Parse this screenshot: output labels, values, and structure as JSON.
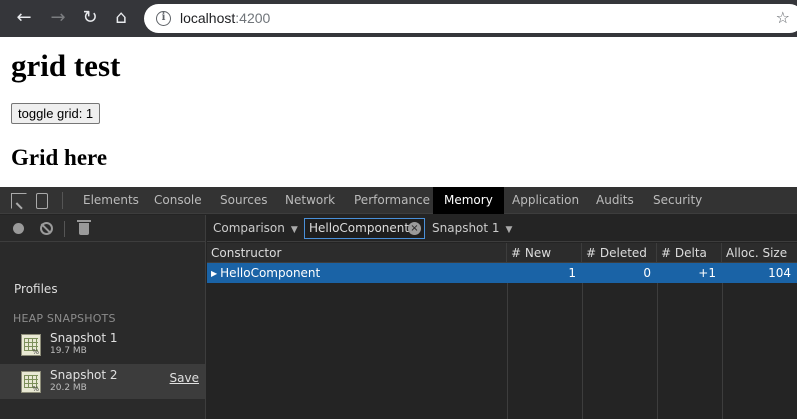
{
  "browser": {
    "url_host": "localhost",
    "url_port": ":4200"
  },
  "page": {
    "title": "grid test",
    "toggle_button": "toggle grid: 1",
    "subtitle": "Grid here"
  },
  "devtools": {
    "tabs": [
      "Elements",
      "Console",
      "Sources",
      "Network",
      "Performance",
      "Memory",
      "Application",
      "Audits",
      "Security"
    ],
    "active_tab": "Memory",
    "sidebar": {
      "profiles_label": "Profiles",
      "heap_header": "HEAP SNAPSHOTS",
      "snapshots": [
        {
          "name": "Snapshot 1",
          "size": "19.7 MB"
        },
        {
          "name": "Snapshot 2",
          "size": "20.2 MB",
          "action": "Save"
        }
      ]
    },
    "toolbar": {
      "view": "Comparison",
      "filter_value": "HelloComponent",
      "base_snapshot": "Snapshot 1"
    },
    "grid": {
      "columns": [
        "Constructor",
        "# New",
        "# Deleted",
        "# Delta",
        "Alloc. Size"
      ],
      "rows": [
        {
          "constructor": "HelloComponent",
          "new": "1",
          "deleted": "0",
          "delta": "+1",
          "alloc_size": "104"
        }
      ]
    }
  }
}
